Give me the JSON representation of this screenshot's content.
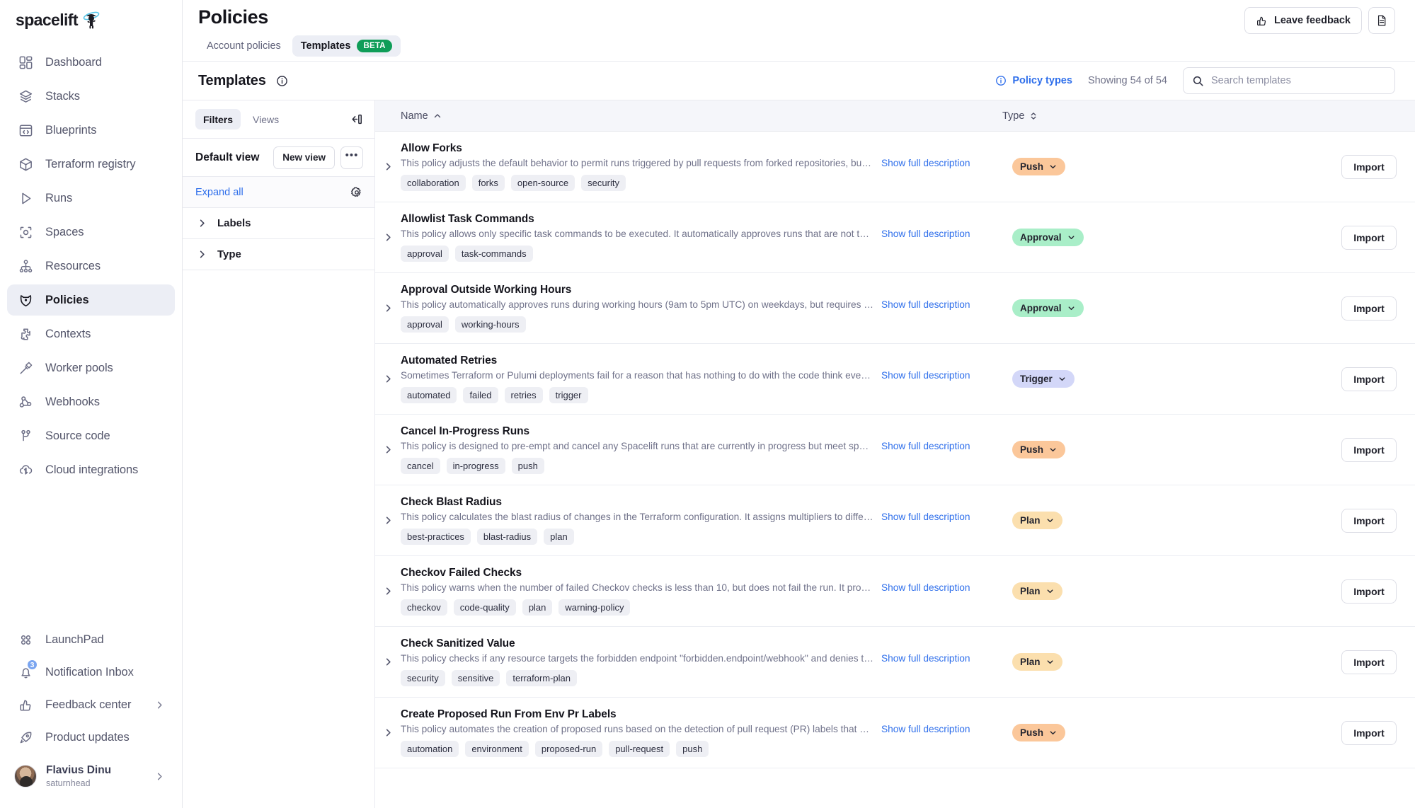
{
  "brand": {
    "name": "spacelift",
    "logo_icon": "astronaut-planet-icon"
  },
  "sidebar": {
    "items": [
      {
        "label": "Dashboard",
        "icon": "dashboard-grid-icon",
        "active": false
      },
      {
        "label": "Stacks",
        "icon": "layers-icon",
        "active": false
      },
      {
        "label": "Blueprints",
        "icon": "code-window-icon",
        "active": false
      },
      {
        "label": "Terraform registry",
        "icon": "cube-icon",
        "active": false
      },
      {
        "label": "Runs",
        "icon": "play-triangle-icon",
        "active": false
      },
      {
        "label": "Spaces",
        "icon": "focus-circle-icon",
        "active": false
      },
      {
        "label": "Resources",
        "icon": "hierarchy-icon",
        "active": false
      },
      {
        "label": "Policies",
        "icon": "shield-eye-icon",
        "active": true
      },
      {
        "label": "Contexts",
        "icon": "puzzle-piece-icon",
        "active": false
      },
      {
        "label": "Worker pools",
        "icon": "hammer-icon",
        "active": false
      },
      {
        "label": "Webhooks",
        "icon": "webhook-icon",
        "active": false
      },
      {
        "label": "Source code",
        "icon": "git-branch-icon",
        "active": false
      },
      {
        "label": "Cloud integrations",
        "icon": "cloud-sync-icon",
        "active": false
      }
    ],
    "bottom_items": [
      {
        "label": "LaunchPad",
        "icon": "four-circles-icon",
        "chevron": false,
        "badge": ""
      },
      {
        "label": "Notification Inbox",
        "icon": "bell-icon",
        "chevron": false,
        "badge": "3"
      },
      {
        "label": "Feedback center",
        "icon": "thumbs-up-icon",
        "chevron": true,
        "badge": ""
      },
      {
        "label": "Product updates",
        "icon": "rocket-icon",
        "chevron": false,
        "badge": ""
      }
    ],
    "user": {
      "name": "Flavius Dinu",
      "handle": "saturnhead",
      "avatar_icon": "user-avatar"
    }
  },
  "header": {
    "title": "Policies",
    "tabs": [
      {
        "label": "Account policies",
        "active": false,
        "badge": ""
      },
      {
        "label": "Templates",
        "active": true,
        "badge": "BETA"
      }
    ],
    "feedback_button": "Leave feedback",
    "feedback_icon": "thumbs-up-icon",
    "docs_icon": "document-icon"
  },
  "subheader": {
    "title": "Templates",
    "info_icon": "info-circle-icon",
    "policy_types_label": "Policy types",
    "policy_types_icon": "info-circle-icon",
    "showing": "Showing 54 of 54",
    "search_placeholder": "Search templates",
    "search_value": "",
    "search_icon": "search-icon"
  },
  "filters": {
    "tabs": [
      {
        "label": "Filters",
        "active": true
      },
      {
        "label": "Views",
        "active": false
      }
    ],
    "collapse_icon": "collapse-panel-icon",
    "view_name": "Default view",
    "new_view_label": "New view",
    "more_label": "•••",
    "expand_all_label": "Expand all",
    "settings_icon": "gear-icon",
    "facets": [
      {
        "label": "Labels",
        "icon": "chevron-right-icon"
      },
      {
        "label": "Type",
        "icon": "chevron-right-icon"
      }
    ]
  },
  "table": {
    "columns": [
      {
        "label": "Name",
        "sort_icon": "caret-up-icon",
        "sorted": true
      },
      {
        "label": "Type",
        "sort_icon": "sort-updown-icon",
        "sorted": false
      }
    ],
    "show_full_label": "Show full description",
    "import_label": "Import",
    "expand_icon": "chevron-right-icon",
    "type_colors": {
      "Push": "#fbc79a",
      "Approval": "#a9eec8",
      "Trigger": "#d3d7f8",
      "Plan": "#fbdfae"
    },
    "rows": [
      {
        "name": "Allow Forks",
        "description": "This policy adjusts the default behavior to permit runs triggered by pull requests from forked repositories, but only for a whitelist o...",
        "tags": [
          "collaboration",
          "forks",
          "open-source",
          "security"
        ],
        "type": "Push",
        "type_class": "t-push"
      },
      {
        "name": "Allowlist Task Commands",
        "description": "This policy allows only specific task commands to be executed. It automatically approves runs that are not tasks, and those with ta...",
        "tags": [
          "approval",
          "task-commands"
        ],
        "type": "Approval",
        "type_class": "t-approval"
      },
      {
        "name": "Approval Outside Working Hours",
        "description": "This policy automatically approves runs during working hours (9am to 5pm UTC) on weekdays, but requires at least one approval ...",
        "tags": [
          "approval",
          "working-hours"
        ],
        "type": "Approval",
        "type_class": "t-approval"
      },
      {
        "name": "Automated Retries",
        "description": "Sometimes Terraform or Pulumi deployments fail for a reason that has nothing to do with the code think eventual consistency bet...",
        "tags": [
          "automated",
          "failed",
          "retries",
          "trigger"
        ],
        "type": "Trigger",
        "type_class": "t-trigger"
      },
      {
        "name": "Cancel In-Progress Runs",
        "description": "This policy is designed to pre-empt and cancel any Spacelift runs that are currently in progress but meet specific criteria. It targets ...",
        "tags": [
          "cancel",
          "in-progress",
          "push"
        ],
        "type": "Push",
        "type_class": "t-push"
      },
      {
        "name": "Check Blast Radius",
        "description": "This policy calculates the blast radius of changes in the Terraform configuration. It assigns multipliers to different types of resource...",
        "tags": [
          "best-practices",
          "blast-radius",
          "plan"
        ],
        "type": "Plan",
        "type_class": "t-plan"
      },
      {
        "name": "Checkov Failed Checks",
        "description": "This policy warns when the number of failed Checkov checks is less than 10, but does not fail the run. It provides visibility into pot...",
        "tags": [
          "checkov",
          "code-quality",
          "plan",
          "warning-policy"
        ],
        "type": "Plan",
        "type_class": "t-plan"
      },
      {
        "name": "Check Sanitized Value",
        "description": "This policy checks if any resource targets the forbidden endpoint \"forbidden.endpoint/webhook\" and denies the action if found. It e...",
        "tags": [
          "security",
          "sensitive",
          "terraform-plan"
        ],
        "type": "Plan",
        "type_class": "t-plan"
      },
      {
        "name": "Create Proposed Run From Env Pr Labels",
        "description": "This policy automates the creation of proposed runs based on the detection of pull request (PR) labels that are prefixed with \"env:...",
        "tags": [
          "automation",
          "environment",
          "proposed-run",
          "pull-request",
          "push"
        ],
        "type": "Push",
        "type_class": "t-push"
      }
    ]
  }
}
